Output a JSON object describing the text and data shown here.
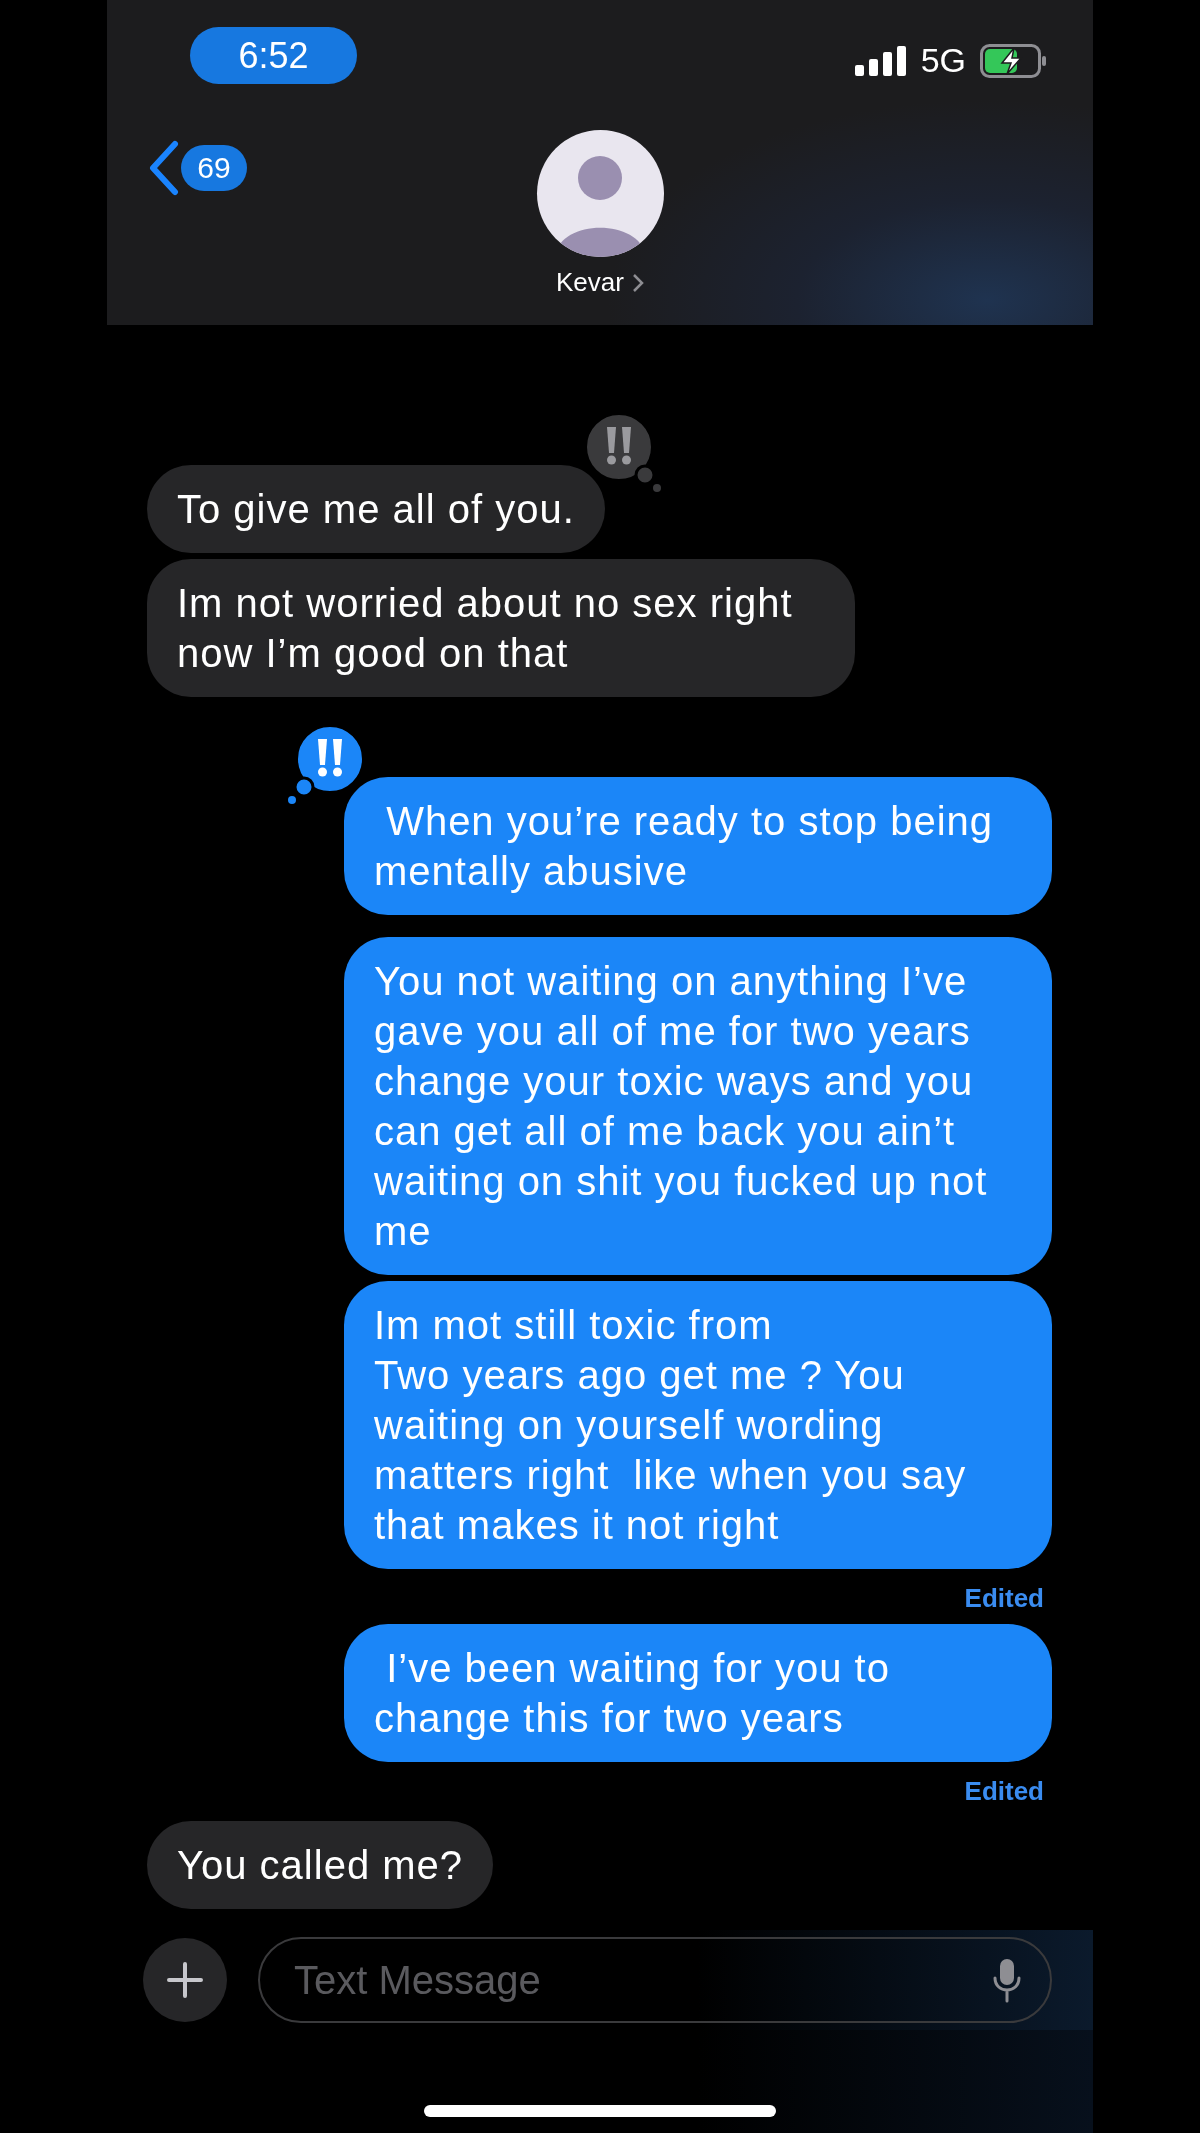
{
  "status_bar": {
    "time": "6:52",
    "network": "5G"
  },
  "header": {
    "back_count": "69",
    "contact_name": "Kevar"
  },
  "messages": [
    {
      "kind": "received",
      "text": "To give me all of you.",
      "emphasized": true
    },
    {
      "kind": "received",
      "text": "Im not worried about no sex right now I’m good on that"
    },
    {
      "kind": "sent",
      "text": " When you’re ready to stop being mentally abusive",
      "emphasized": true
    },
    {
      "kind": "sent",
      "text": "You not waiting on anything I’ve gave you all of me for two years change your toxic ways and you can get all of me back you ain’t waiting on shit you fucked up not me"
    },
    {
      "kind": "sent",
      "text": "Im mot still toxic from\nTwo years ago get me ? You waiting on yourself wording matters right  like when you say that makes it not right",
      "note": "Edited"
    },
    {
      "kind": "sent",
      "text": " I’ve been waiting for you to change this for two years",
      "note": "Edited"
    },
    {
      "kind": "received",
      "text": "You called me?"
    }
  ],
  "composer": {
    "placeholder": "Text Message"
  }
}
